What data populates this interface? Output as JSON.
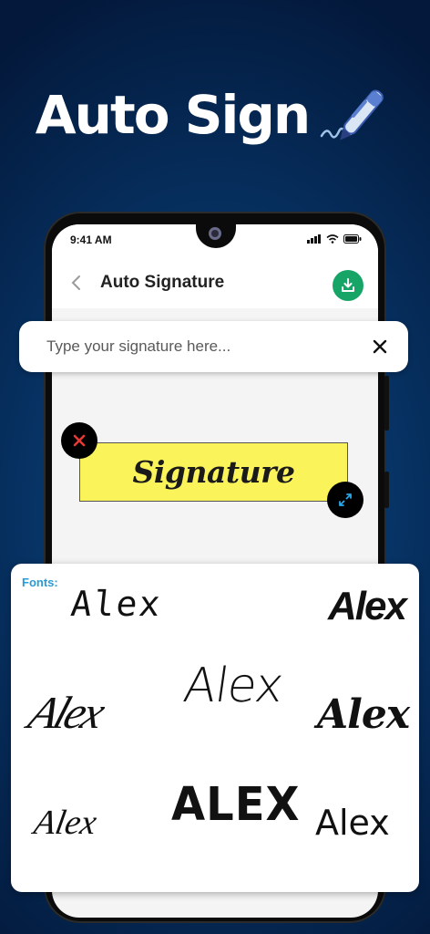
{
  "headline": {
    "text": "Auto Sign"
  },
  "status_bar": {
    "time": "9:41 AM"
  },
  "app_bar": {
    "title": "Auto Signature"
  },
  "search": {
    "placeholder": "Type your signature here..."
  },
  "signature": {
    "text": "Signature",
    "background": "#fbf35a"
  },
  "fonts": {
    "label": "Fonts:",
    "options": [
      "Alex",
      "Alex",
      "Alex",
      "Alex",
      "Alex",
      "Alex",
      "ALEX",
      "Alex"
    ]
  },
  "colors": {
    "accent_green": "#17a567",
    "fonts_label": "#2a9bd6",
    "delete_x": "#e53935",
    "resize_arrows": "#2aa7e8"
  },
  "icons": [
    "pen-icon",
    "back-icon",
    "download-icon",
    "close-icon",
    "delete-x-icon",
    "resize-arrows-icon",
    "signal-icon",
    "wifi-icon",
    "battery-icon"
  ]
}
